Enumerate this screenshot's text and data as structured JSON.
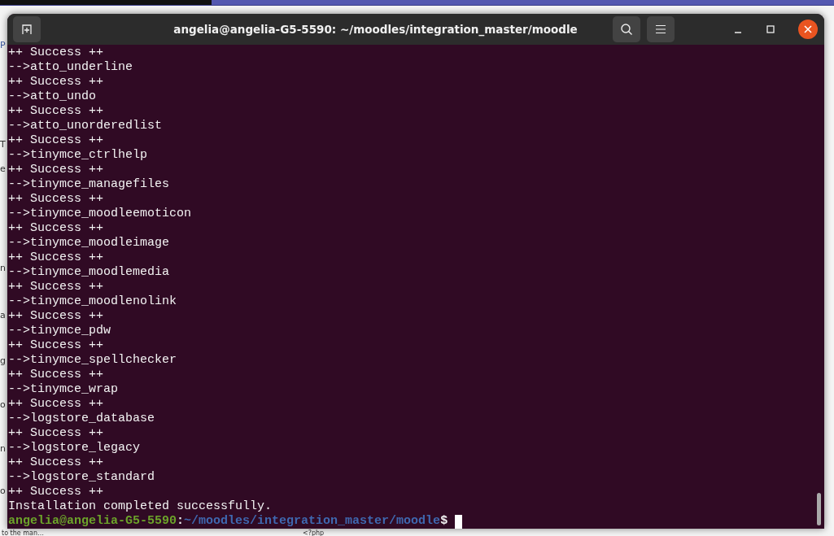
{
  "background_window": {
    "side_fragments": [
      "P",
      "T",
      "e",
      "n",
      "a",
      "g",
      "o",
      "n",
      "o"
    ],
    "bottom_fragments": [
      "to the man…",
      "<?php"
    ]
  },
  "window": {
    "title": "angelia@angelia-G5-5590: ~/moodles/integration_master/moodle"
  },
  "terminal": {
    "lines": [
      {
        "kind": "output",
        "text": "++ Success ++"
      },
      {
        "kind": "output",
        "text": "-->atto_underline"
      },
      {
        "kind": "output",
        "text": "++ Success ++"
      },
      {
        "kind": "output",
        "text": "-->atto_undo"
      },
      {
        "kind": "output",
        "text": "++ Success ++"
      },
      {
        "kind": "output",
        "text": "-->atto_unorderedlist"
      },
      {
        "kind": "output",
        "text": "++ Success ++"
      },
      {
        "kind": "output",
        "text": "-->tinymce_ctrlhelp"
      },
      {
        "kind": "output",
        "text": "++ Success ++"
      },
      {
        "kind": "output",
        "text": "-->tinymce_managefiles"
      },
      {
        "kind": "output",
        "text": "++ Success ++"
      },
      {
        "kind": "output",
        "text": "-->tinymce_moodleemoticon"
      },
      {
        "kind": "output",
        "text": "++ Success ++"
      },
      {
        "kind": "output",
        "text": "-->tinymce_moodleimage"
      },
      {
        "kind": "output",
        "text": "++ Success ++"
      },
      {
        "kind": "output",
        "text": "-->tinymce_moodlemedia"
      },
      {
        "kind": "output",
        "text": "++ Success ++"
      },
      {
        "kind": "output",
        "text": "-->tinymce_moodlenolink"
      },
      {
        "kind": "output",
        "text": "++ Success ++"
      },
      {
        "kind": "output",
        "text": "-->tinymce_pdw"
      },
      {
        "kind": "output",
        "text": "++ Success ++"
      },
      {
        "kind": "output",
        "text": "-->tinymce_spellchecker"
      },
      {
        "kind": "output",
        "text": "++ Success ++"
      },
      {
        "kind": "output",
        "text": "-->tinymce_wrap"
      },
      {
        "kind": "output",
        "text": "++ Success ++"
      },
      {
        "kind": "output",
        "text": "-->logstore_database"
      },
      {
        "kind": "output",
        "text": "++ Success ++"
      },
      {
        "kind": "output",
        "text": "-->logstore_legacy"
      },
      {
        "kind": "output",
        "text": "++ Success ++"
      },
      {
        "kind": "output",
        "text": "-->logstore_standard"
      },
      {
        "kind": "output",
        "text": "++ Success ++"
      },
      {
        "kind": "output",
        "text": "Installation completed successfully."
      },
      {
        "kind": "prompt",
        "user": "angelia@angelia-G5-5590",
        "separator": ":",
        "path": "~/moodles/integration_master/moodle",
        "symbol": "$"
      }
    ]
  }
}
